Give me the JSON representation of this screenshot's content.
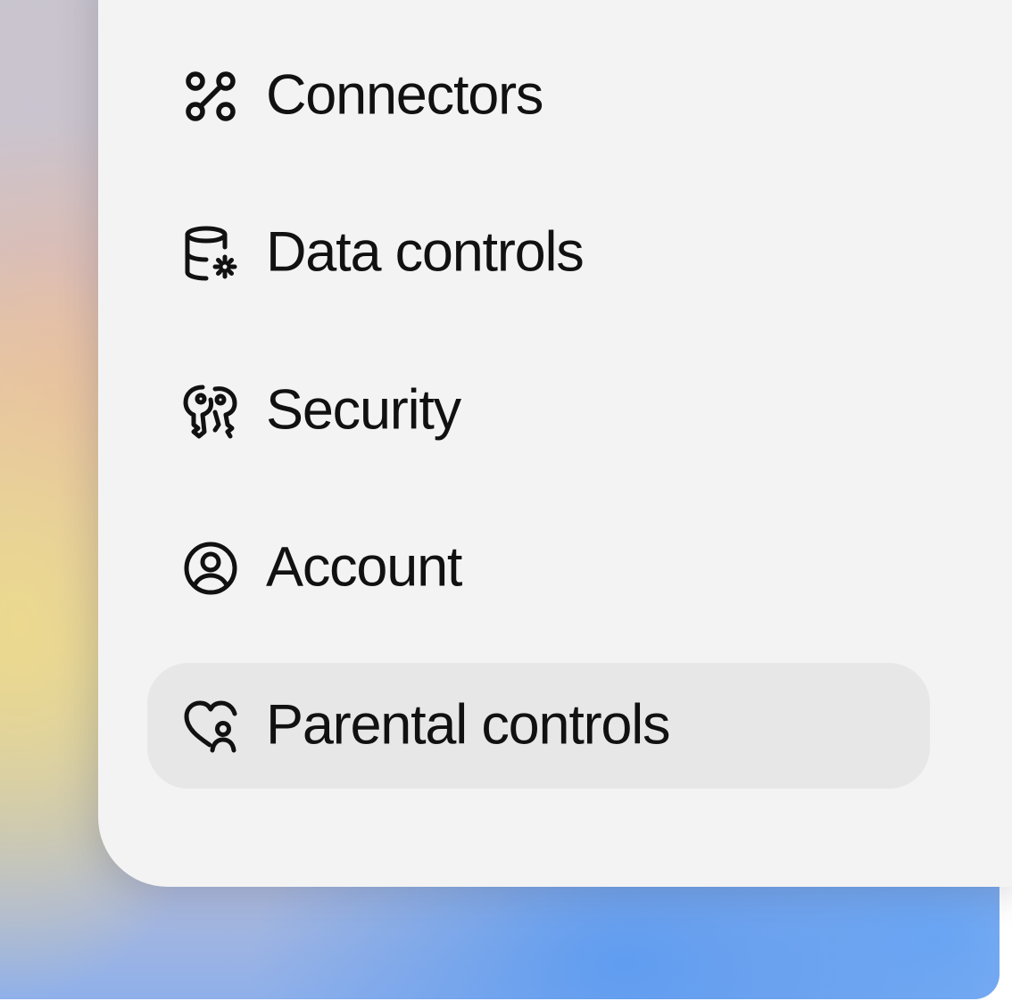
{
  "menu": {
    "items": [
      {
        "label": "Connectors",
        "icon": "connectors-icon"
      },
      {
        "label": "Data controls",
        "icon": "database-gear-icon"
      },
      {
        "label": "Security",
        "icon": "keys-icon"
      },
      {
        "label": "Account",
        "icon": "user-circle-icon"
      },
      {
        "label": "Parental controls",
        "icon": "heart-person-icon",
        "selected": true
      }
    ]
  },
  "colors": {
    "panel": "#f3f3f3",
    "selected_item": "#e7e7e7",
    "text": "#111111",
    "backdrop_accent": "#5f9cf0"
  }
}
